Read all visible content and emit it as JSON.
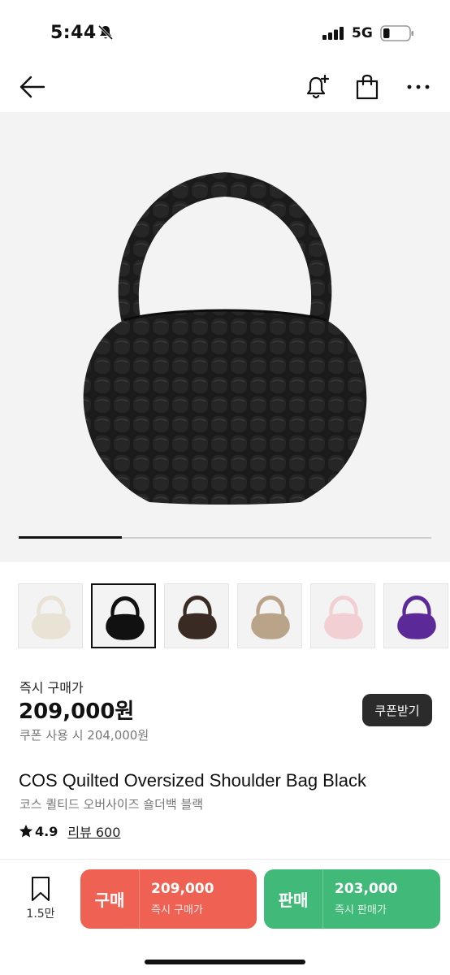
{
  "status_bar": {
    "time": "5:44",
    "network": "5G",
    "battery_level": 0.25
  },
  "nav": {
    "icons": [
      "back-arrow-icon",
      "alert-add-icon",
      "shopping-bag-icon",
      "more-icon"
    ]
  },
  "gallery": {
    "progress": 0.25,
    "main_image": "black quilted shoulder bag"
  },
  "thumbnails": [
    {
      "color": "#e9e3d6",
      "name": "ivory"
    },
    {
      "color": "#111111",
      "name": "black"
    },
    {
      "color": "#3a2a24",
      "name": "brown"
    },
    {
      "color": "#b9a48a",
      "name": "beige"
    },
    {
      "color": "#f2cfd2",
      "name": "pink"
    },
    {
      "color": "#5b2a98",
      "name": "purple"
    }
  ],
  "price": {
    "label": "즉시 구매가",
    "value": "209,000원",
    "coupon_text": "쿠폰 사용 시 204,000원",
    "coupon_button": "쿠폰받기"
  },
  "product": {
    "title": "COS Quilted Oversized Shoulder Bag Black",
    "subtitle": "코스 퀼티드 오버사이즈 숄더백 블랙",
    "rating": "4.9",
    "reviews": "리뷰 600"
  },
  "bottom_bar": {
    "wish_count": "1.5만",
    "buy": {
      "label": "구매",
      "price": "209,000",
      "sub": "즉시 구매가"
    },
    "sell": {
      "label": "판매",
      "price": "203,000",
      "sub": "즉시 판매가"
    }
  },
  "colors": {
    "buy": "#ef6253",
    "sell": "#41b979",
    "coupon_button": "#2b2b2b"
  }
}
